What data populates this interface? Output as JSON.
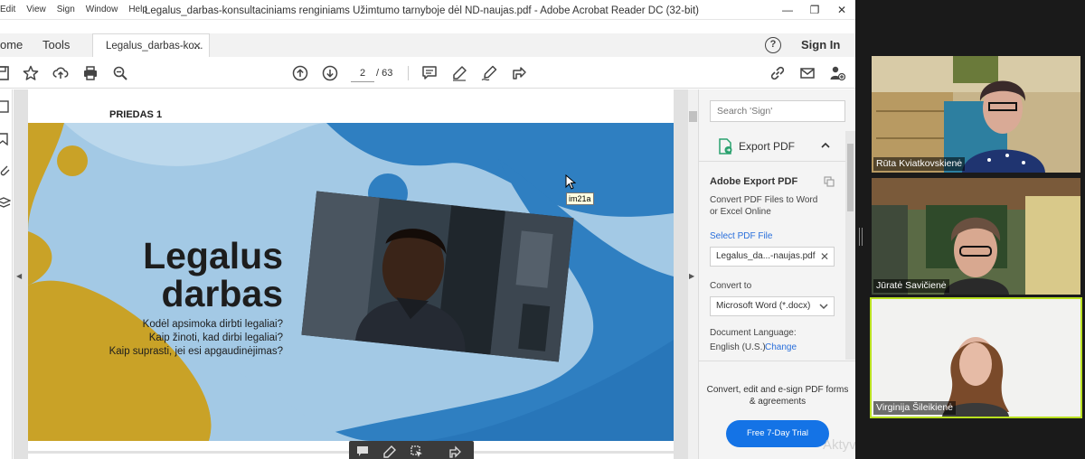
{
  "window": {
    "title": "Legalus_darbas-konsultaciniams renginiams Užimtumo tarnyboje dėl ND-naujas.pdf - Adobe Acrobat Reader DC (32-bit)",
    "menu": [
      "Edit",
      "View",
      "Sign",
      "Window",
      "Help"
    ],
    "controls": {
      "minimize": "—",
      "maximize": "❐",
      "close": "✕"
    }
  },
  "tabs": {
    "home": "ome",
    "tools": "Tools",
    "document": "Legalus_darbas-ko...",
    "close": "✕",
    "help": "?",
    "sign_in": "Sign In"
  },
  "toolbar": {
    "current_page": "2",
    "total_pages": "/ 63",
    "icons": [
      "save-icon",
      "bookmark-star-icon",
      "upload-cloud-icon",
      "print-icon",
      "zoom-icon",
      "page-up-icon",
      "page-down-icon",
      "comment-icon",
      "highlight-pen-icon",
      "sign-pen-icon",
      "share-icon",
      "link-icon",
      "email-icon",
      "add-user-icon"
    ]
  },
  "document": {
    "page_heading": "PRIEDAS 1",
    "slide_title_line1": "Legalus",
    "slide_title_line2": "darbas",
    "slide_line1": "Kodėl apsimoka dirbti legaliai?",
    "slide_line2": "Kaip žinoti, kad dirbi legaliai?",
    "slide_line3": "Kaip suprasti, jei esi apgaudinėjimas?",
    "tooltip": "im21a",
    "colors": {
      "slide_bg": "#a3c9e5",
      "mustard": "#c9a227",
      "blue": "#2f7fc1"
    }
  },
  "right_pane": {
    "search_placeholder": "Search 'Sign'",
    "export_header": "Export PDF",
    "section_title": "Adobe Export PDF",
    "description": "Convert PDF Files to Word or Excel Online",
    "select_label": "Select PDF File",
    "file_name": "Legalus_da...-naujas.pdf",
    "convert_label": "Convert to",
    "convert_value": "Microsoft Word (*.docx)",
    "language_label": "Document Language:",
    "language_value": "English (U.S.)",
    "language_change": "Change",
    "promo": "Convert, edit and e-sign PDF forms & agreements",
    "trial_button": "Free 7-Day Trial"
  },
  "watermark": "Aktyvinti „Windows“",
  "participants": [
    {
      "name": "Rūta Kviatkovskienė"
    },
    {
      "name": "Jūratė Savičienė"
    },
    {
      "name": "Virginija Šileikienė",
      "active": true
    }
  ]
}
